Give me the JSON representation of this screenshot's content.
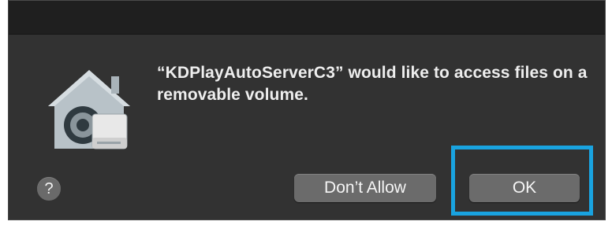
{
  "dialog": {
    "message": "“KDPlayAutoServerC3” would like to access files on a removable volume.",
    "icon": "house-lock-drive-icon",
    "help_icon": "?",
    "buttons": {
      "dont_allow": "Don’t Allow",
      "ok": "OK"
    },
    "highlight_color": "#19a3e0",
    "background_color": "#323232"
  }
}
